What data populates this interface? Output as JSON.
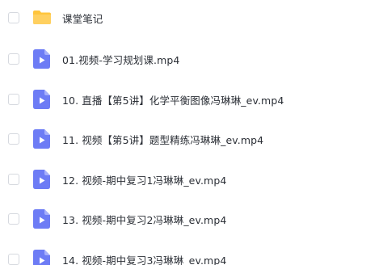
{
  "files": [
    {
      "name": "课堂笔记",
      "icon": "folder-icon"
    },
    {
      "name": "01.视频-学习规划课.mp4",
      "icon": "video-file-icon"
    },
    {
      "name": "10. 直播【第5讲】化学平衡图像冯琳琳_ev.mp4",
      "icon": "video-file-icon"
    },
    {
      "name": "11. 视频【第5讲】题型精练冯琳琳_ev.mp4",
      "icon": "video-file-icon"
    },
    {
      "name": "12. 视频-期中复习1冯琳琳_ev.mp4",
      "icon": "video-file-icon"
    },
    {
      "name": "13. 视频-期中复习2冯琳琳_ev.mp4",
      "icon": "video-file-icon"
    },
    {
      "name": "14. 视频-期中复习3冯琳琳_ev.mp4",
      "icon": "video-file-icon"
    }
  ],
  "colors": {
    "folder": "#ffc53d",
    "video_icon": "#6d7cf5",
    "text": "#2b2f36",
    "checkbox_border": "#d6d9df"
  }
}
